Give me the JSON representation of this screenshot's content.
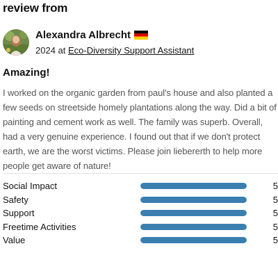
{
  "section": {
    "heading": "review from"
  },
  "reviewer": {
    "name": "Alexandra Albrecht",
    "flag": "germany-flag",
    "year": "2024",
    "at_text": "at",
    "organization": "Eco-Diversity Support Assistant"
  },
  "review": {
    "title": "Amazing!",
    "body": "I worked on the organic garden from paul's house and also planted a few seeds on streetside homely plantations along the way. Did a bit of painting and cement work as well. The family was superb. Overall, had a very genuine experience. I found out that if we don't protect earth, we are the worst victims. Please join liebererth to help more people get aware of nature!"
  },
  "ratings": {
    "max": 5,
    "bar_color": "#3a7fb0",
    "items": [
      {
        "label": "Social Impact",
        "score": "5",
        "value": 5
      },
      {
        "label": "Safety",
        "score": "5",
        "value": 5
      },
      {
        "label": "Support",
        "score": "5",
        "value": 5
      },
      {
        "label": "Freetime Activities",
        "score": "5",
        "value": 5
      },
      {
        "label": "Value",
        "score": "5",
        "value": 5
      }
    ]
  }
}
